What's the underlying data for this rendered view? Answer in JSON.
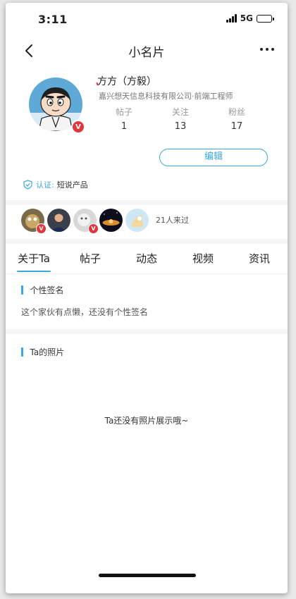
{
  "status_bar": {
    "time": "3:11",
    "network": "5G"
  },
  "nav": {
    "title": "小名片",
    "back_icon": "chevron-left-icon",
    "more_icon": "ellipsis-icon"
  },
  "profile": {
    "name": "方方（方毅）",
    "company": "嘉兴想天信息科技有限公司·前端工程师",
    "verified_badge": "V",
    "stats": [
      {
        "label": "帖子",
        "value": "1"
      },
      {
        "label": "关注",
        "value": "13"
      },
      {
        "label": "粉丝",
        "value": "17"
      }
    ],
    "edit_label": "编辑"
  },
  "verification": {
    "label": "认证:",
    "value": "短说产品",
    "icon": "shield-check-icon"
  },
  "visitors": {
    "count_text": "21人来过",
    "avatars": [
      {
        "name": "visitor-avatar-1",
        "badge": "V"
      },
      {
        "name": "visitor-avatar-2",
        "badge": ""
      },
      {
        "name": "visitor-avatar-3",
        "badge": "V"
      },
      {
        "name": "visitor-avatar-4",
        "badge": ""
      },
      {
        "name": "visitor-avatar-5",
        "badge": ""
      }
    ]
  },
  "tabs": [
    {
      "label": "关于Ta",
      "active": true
    },
    {
      "label": "帖子",
      "active": false
    },
    {
      "label": "动态",
      "active": false
    },
    {
      "label": "视频",
      "active": false
    },
    {
      "label": "资讯",
      "active": false
    }
  ],
  "about": {
    "signature_title": "个性签名",
    "signature_text": "这个家伙有点懒，还没有个性签名",
    "photos_title": "Ta的照片",
    "photos_empty": "Ta还没有照片展示哦~"
  },
  "colors": {
    "accent": "#3aa7df",
    "badge_red": "#e2363c",
    "divider": "#f5f5f5"
  }
}
